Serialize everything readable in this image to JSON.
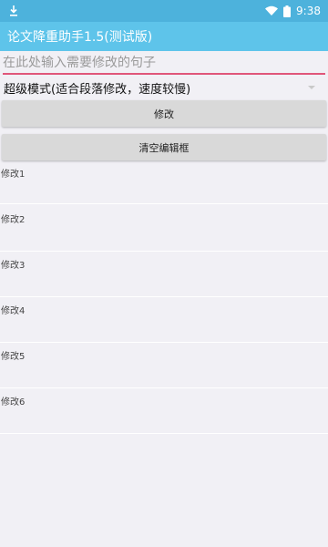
{
  "status_bar": {
    "time": "9:38",
    "icons": [
      "download-icon",
      "wifi-icon",
      "battery-icon"
    ]
  },
  "app_bar": {
    "title": "论文降重助手1.5(测试版)"
  },
  "sentence_input": {
    "placeholder": "在此处输入需要修改的句子",
    "value": ""
  },
  "mode_select": {
    "selected": "超级模式(适合段落修改，速度较慢)"
  },
  "buttons": {
    "modify": "修改",
    "clear": "清空编辑框"
  },
  "results": [
    {
      "label": "修改1"
    },
    {
      "label": "修改2"
    },
    {
      "label": "修改3"
    },
    {
      "label": "修改4"
    },
    {
      "label": "修改5"
    },
    {
      "label": "修改6"
    }
  ],
  "colors": {
    "status_bar": "#4db2dc",
    "app_bar": "#5ec4ea",
    "accent_underline": "#e0567a",
    "background": "#f1f0f5",
    "button": "#d9d9d9"
  }
}
